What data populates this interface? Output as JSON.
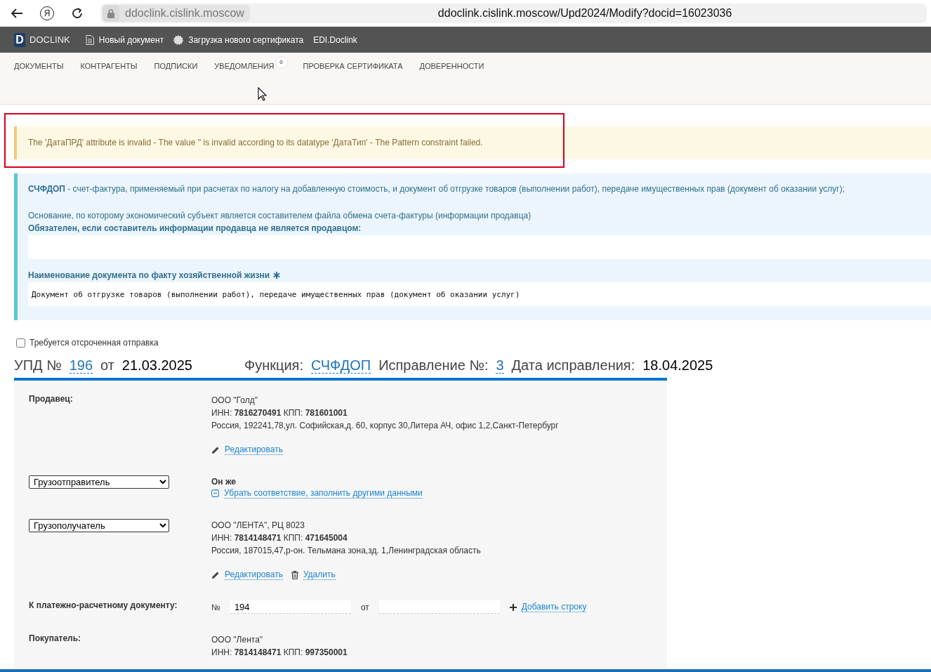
{
  "browser": {
    "home_glyph": "Я",
    "host": "ddoclink.cislink.moscow",
    "url": "ddoclink.cislink.moscow/Upd2024/Modify?docid=16023036"
  },
  "navbar": {
    "logo_letter": "D",
    "brand": "DOCLINK",
    "items": [
      {
        "kind": "document",
        "label": "Новый документ"
      },
      {
        "kind": "certificate",
        "label": "Загрузка нового сертификата"
      },
      {
        "kind": "plain",
        "label": "EDI.Doclink"
      }
    ]
  },
  "tabs": [
    {
      "label": "ДОКУМЕНТЫ"
    },
    {
      "label": "КОНТРАГЕНТЫ"
    },
    {
      "label": "ПОДПИСКИ"
    },
    {
      "label": "УВЕДОМЛЕНИЯ",
      "badge": "0"
    },
    {
      "label": "ПРОВЕРКА СЕРТИФИКАТА"
    },
    {
      "label": "ДОВЕРЕННОСТИ"
    }
  ],
  "alert": {
    "text": "The 'ДатаПРД' attribute is invalid - The value '' is invalid according to its datatype 'ДатаТип' - The Pattern constraint failed.",
    "highlighted": true
  },
  "info": {
    "intro": "**СЧФДОП** - счет-фактура, применяемый при расчетах по налогу на добавленную стоимость, и документ об отгрузке товаров (выполнении работ), передаче имущественных прав (документ об оказании услуг);",
    "basis_hint": "Основание, по которому экономический субъект является составителем файла обмена счета-фактуры (информации продавца)",
    "basis_label": "Обязателен, если составитель информации продавца не является продавцом:",
    "name_label": "Наименование документа по факту хозяйственной жизни",
    "name_required": true,
    "name_value": "Документ об отгрузке товаров (выполнении работ), передаче имущественных прав (документ об оказании услуг)"
  },
  "deferred": {
    "label": "Требуется отсроченная отправка",
    "checked": false
  },
  "heading": [
    {
      "kind": "label",
      "text": "УПД №"
    },
    {
      "kind": "link",
      "text": "196"
    },
    {
      "kind": "label",
      "text": "от"
    },
    {
      "kind": "value",
      "text": "21.03.2025"
    },
    {
      "kind": "spacer"
    },
    {
      "kind": "label",
      "text": "Функция:"
    },
    {
      "kind": "link",
      "text": "СЧФДОП"
    },
    {
      "kind": "label",
      "text": "Исправление №:"
    },
    {
      "kind": "link",
      "text": "3"
    },
    {
      "kind": "label",
      "text": "Дата исправления:"
    },
    {
      "kind": "value",
      "text": "18.04.2025"
    }
  ],
  "form": [
    {
      "kind": "party",
      "label": "Продавец:",
      "lines": [
        "ООО \"Голд\"",
        "ИНН: **7816270491** КПП: **781601001**",
        "Россия, 192241,78,ул. Софийская,д. 60, корпус 30,Литера АЧ, офис 1,2,Санкт-Петербург"
      ],
      "actions": [
        {
          "kind": "edit",
          "label": "Редактировать"
        }
      ]
    },
    {
      "kind": "party",
      "select": "Грузоотправитель",
      "same": "Он же",
      "actions": [
        {
          "kind": "unlink",
          "label": "Убрать соответствие, заполнить другими данными"
        }
      ]
    },
    {
      "kind": "party",
      "select": "Грузополучатель",
      "lines": [
        "ООО \"ЛЕНТА\", РЦ 8023",
        "ИНН: **7814148471** КПП: **471645004**",
        "Россия, 187015,47,р-он. Тельмана зона,зд. 1,Ленинградская область"
      ],
      "actions": [
        {
          "kind": "edit",
          "label": "Редактировать"
        },
        {
          "kind": "delete",
          "label": "Удалить"
        }
      ]
    },
    {
      "kind": "payment",
      "label": "К платежно-расчетному документу:",
      "number_label": "№",
      "number": "194",
      "date_label": "от",
      "add": "Добавить строку"
    },
    {
      "kind": "party",
      "label": "Покупатель:",
      "lines": [
        "ООО \"Лента\"",
        "ИНН: **7814148471** КПП: **997350001**"
      ]
    }
  ]
}
